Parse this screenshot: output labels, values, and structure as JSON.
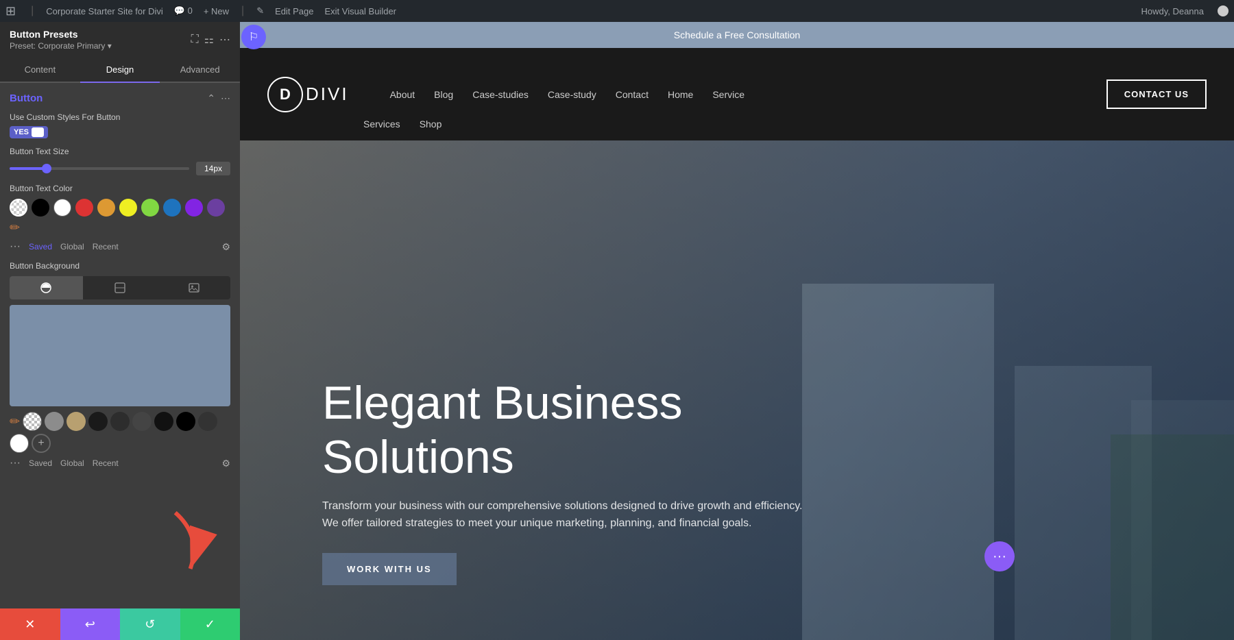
{
  "admin_bar": {
    "wp_logo": "⊞",
    "site_name": "Corporate Starter Site for Divi",
    "comment_icon": "💬",
    "comment_count": "0",
    "new_label": "+ New",
    "edit_page_label": "Edit Page",
    "exit_builder_label": "Exit Visual Builder",
    "howdy_label": "Howdy, Deanna"
  },
  "panel": {
    "title": "Button Presets",
    "subtitle": "Preset: Corporate Primary ▾",
    "tabs": [
      {
        "id": "content",
        "label": "Content"
      },
      {
        "id": "design",
        "label": "Design"
      },
      {
        "id": "advanced",
        "label": "Advanced"
      }
    ],
    "active_tab": "design",
    "section_title": "Button",
    "use_custom_label": "Use Custom Styles For Button",
    "toggle_yes": "YES",
    "button_text_size_label": "Button Text Size",
    "button_text_size_value": "14px",
    "button_text_color_label": "Button Text Color",
    "button_background_label": "Button Background",
    "color_tabs": {
      "saved": "Saved",
      "global": "Global",
      "recent": "Recent"
    },
    "colors": [
      {
        "id": "transparent",
        "hex": "transparent",
        "label": "Transparent"
      },
      {
        "id": "black",
        "hex": "#000000",
        "label": "Black"
      },
      {
        "id": "white",
        "hex": "#ffffff",
        "label": "White"
      },
      {
        "id": "red",
        "hex": "#dd3333",
        "label": "Red"
      },
      {
        "id": "orange",
        "hex": "#dd9933",
        "label": "Orange"
      },
      {
        "id": "yellow",
        "hex": "#eeee22",
        "label": "Yellow"
      },
      {
        "id": "green",
        "hex": "#81d742",
        "label": "Green"
      },
      {
        "id": "blue",
        "hex": "#1e73be",
        "label": "Blue"
      },
      {
        "id": "purple",
        "hex": "#8224e3",
        "label": "Purple"
      },
      {
        "id": "dark-purple",
        "hex": "#6b3fa0",
        "label": "Dark Purple"
      },
      {
        "id": "pencil",
        "hex": "pencil",
        "label": "Pencil"
      }
    ],
    "bg_colors": [
      {
        "id": "transparent2",
        "hex": "transparent",
        "label": "Transparent"
      },
      {
        "id": "gray1",
        "hex": "#8c8c8c",
        "label": "Gray"
      },
      {
        "id": "tan",
        "hex": "#b8a070",
        "label": "Tan"
      },
      {
        "id": "dark1",
        "hex": "#1a1a1a",
        "label": "Dark"
      },
      {
        "id": "dark2",
        "hex": "#2d2d2d",
        "label": "Dark 2"
      },
      {
        "id": "dark3",
        "hex": "#3d3d3d",
        "label": "Dark 3"
      },
      {
        "id": "dark4",
        "hex": "#1a1a1a",
        "label": "Very Dark"
      },
      {
        "id": "black2",
        "hex": "#000000",
        "label": "Black 2"
      },
      {
        "id": "dark5",
        "hex": "#333",
        "label": "Dark 5"
      },
      {
        "id": "white2",
        "hex": "#ffffff",
        "label": "White 2"
      }
    ],
    "footer_buttons": [
      {
        "id": "cancel",
        "label": "✕",
        "color": "red"
      },
      {
        "id": "reset",
        "label": "↩",
        "color": "purple"
      },
      {
        "id": "redo",
        "label": "↺",
        "color": "teal"
      },
      {
        "id": "save",
        "label": "✓",
        "color": "green"
      }
    ]
  },
  "site": {
    "schedule_bar_text": "Schedule a Free Consultation",
    "logo_letter": "D",
    "logo_wordmark": "DIVI",
    "nav_links": [
      "About",
      "Blog",
      "Case-studies",
      "Case-study",
      "Contact",
      "Home",
      "Service"
    ],
    "nav_second_row": [
      "Services",
      "Shop"
    ],
    "contact_btn_label": "CONTACT US",
    "hero_title": "Elegant Business Solutions",
    "hero_subtitle": "Transform your business with our comprehensive solutions designed to drive growth and efficiency. We offer tailored strategies to meet your unique marketing, planning, and financial goals.",
    "hero_cta_label": "WORK WITH US",
    "float_dots": "···"
  }
}
